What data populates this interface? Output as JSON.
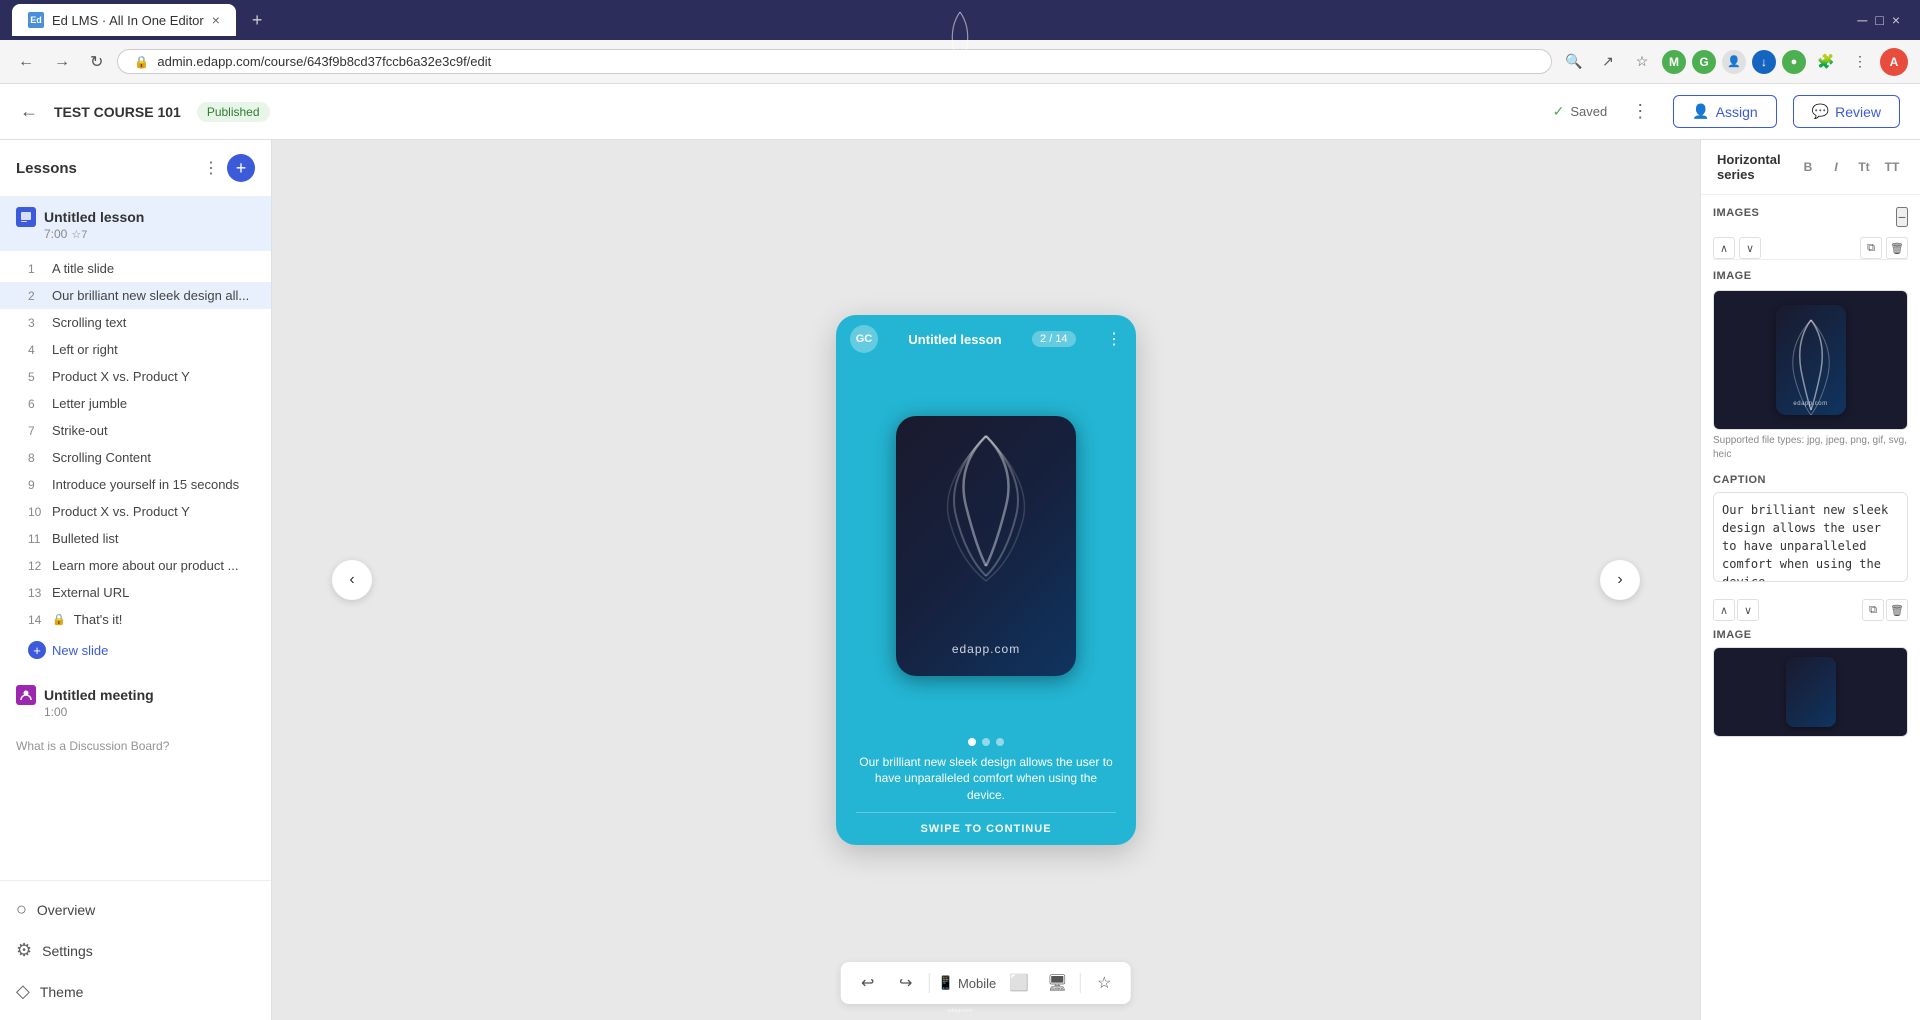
{
  "browser": {
    "tab_favicon": "Ed",
    "tab_title": "Ed LMS · All In One Editor",
    "tab_close": "×",
    "tab_add": "+",
    "address": "admin.edapp.com/course/643f9b8cd37fccb6a32e3c9f/edit",
    "lock_icon": "🔒"
  },
  "header": {
    "back_icon": "←",
    "course_title": "TEST COURSE 101",
    "published_label": "Published",
    "more_icon": "⋮",
    "saved_label": "Saved",
    "saved_icon": "✓",
    "assign_label": "Assign",
    "assign_icon": "👤",
    "review_label": "Review",
    "review_icon": "💬"
  },
  "sidebar": {
    "title": "Lessons",
    "more_icon": "⋮",
    "add_icon": "+",
    "lesson": {
      "name": "Untitled lesson",
      "time": "7:00",
      "stars": "☆7"
    },
    "slides": [
      {
        "num": "1",
        "name": "A title slide",
        "locked": false
      },
      {
        "num": "2",
        "name": "Our brilliant new sleek design all...",
        "locked": false
      },
      {
        "num": "3",
        "name": "Scrolling text",
        "locked": false
      },
      {
        "num": "4",
        "name": "Left or right",
        "locked": false
      },
      {
        "num": "5",
        "name": "Product X vs. Product Y",
        "locked": false
      },
      {
        "num": "6",
        "name": "Letter jumble",
        "locked": false
      },
      {
        "num": "7",
        "name": "Strike-out",
        "locked": false
      },
      {
        "num": "8",
        "name": "Scrolling Content",
        "locked": false
      },
      {
        "num": "9",
        "name": "Introduce yourself in 15 seconds",
        "locked": false
      },
      {
        "num": "10",
        "name": "Product X vs. Product Y",
        "locked": false
      },
      {
        "num": "11",
        "name": "Bulleted list",
        "locked": false
      },
      {
        "num": "12",
        "name": "Learn more about our product ...",
        "locked": false
      },
      {
        "num": "13",
        "name": "External URL",
        "locked": false
      },
      {
        "num": "14",
        "name": "That's it!",
        "locked": true
      }
    ],
    "new_slide": "New slide",
    "meeting_name": "Untitled meeting",
    "meeting_time": "1:00",
    "discussion_name": "What is a Discussion Board?",
    "nav_items": [
      {
        "id": "overview",
        "label": "Overview",
        "icon": "○"
      },
      {
        "id": "settings",
        "label": "Settings",
        "icon": "⚙"
      },
      {
        "id": "theme",
        "label": "Theme",
        "icon": "◇"
      }
    ]
  },
  "phone_preview": {
    "app_icon": "GC",
    "lesson_title": "Untitled lesson",
    "progress": "2 / 14",
    "menu_icon": "⋮",
    "caption": "Our brilliant new sleek design allows the user to have unparalleled comfort when using the device.",
    "swipe_label": "SWIPE TO CONTINUE",
    "nav_prev": "‹",
    "nav_next": "›",
    "dots": [
      true,
      false,
      false
    ]
  },
  "toolbar": {
    "undo_icon": "↩",
    "redo_icon": "↪",
    "mobile_label": "Mobile",
    "mobile_icon": "📱",
    "tablet_icon": "⬜",
    "desktop_icon": "🖥",
    "star_icon": "☆"
  },
  "right_panel": {
    "series_label": "Horizontal series",
    "format_btns": [
      "B",
      "I",
      "Tt",
      "TT"
    ],
    "collapse_icon": "−",
    "section": "Images",
    "img_section_label": "IMAGE",
    "img_supported": "Supported file types: jpg, jpeg, png, gif, svg, heic",
    "caption_label": "CAPTION",
    "caption_text": "Our brilliant new sleek design allows the user to have unparalleled comfort when using the device.",
    "img2_section_label": "IMAGE",
    "nav_up": "∧",
    "nav_down": "∨",
    "copy_icon": "⧉",
    "delete_icon": "🗑"
  }
}
